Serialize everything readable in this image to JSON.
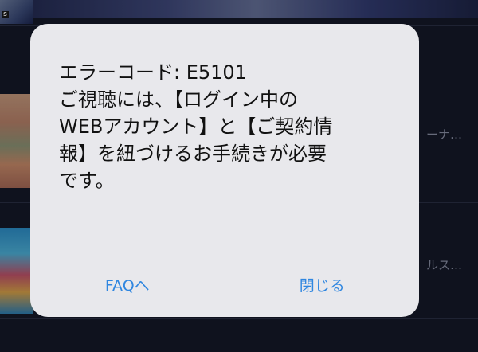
{
  "background": {
    "top_thumb_tag": "S",
    "row_mid_trailing": "ーナ…",
    "row_bot_trailing": "ルス…"
  },
  "alert": {
    "message": "エラーコード: E5101\nご視聴には、【ログイン中の\nWEBアカウント】と【ご契約情\n報】を紐づけるお手続きが必要\nです。",
    "left_button": "FAQへ",
    "right_button": "閉じる"
  },
  "colors": {
    "alert_bg": "#e8e8ec",
    "button_text": "#2f86e0",
    "page_bg": "#161a2b"
  }
}
